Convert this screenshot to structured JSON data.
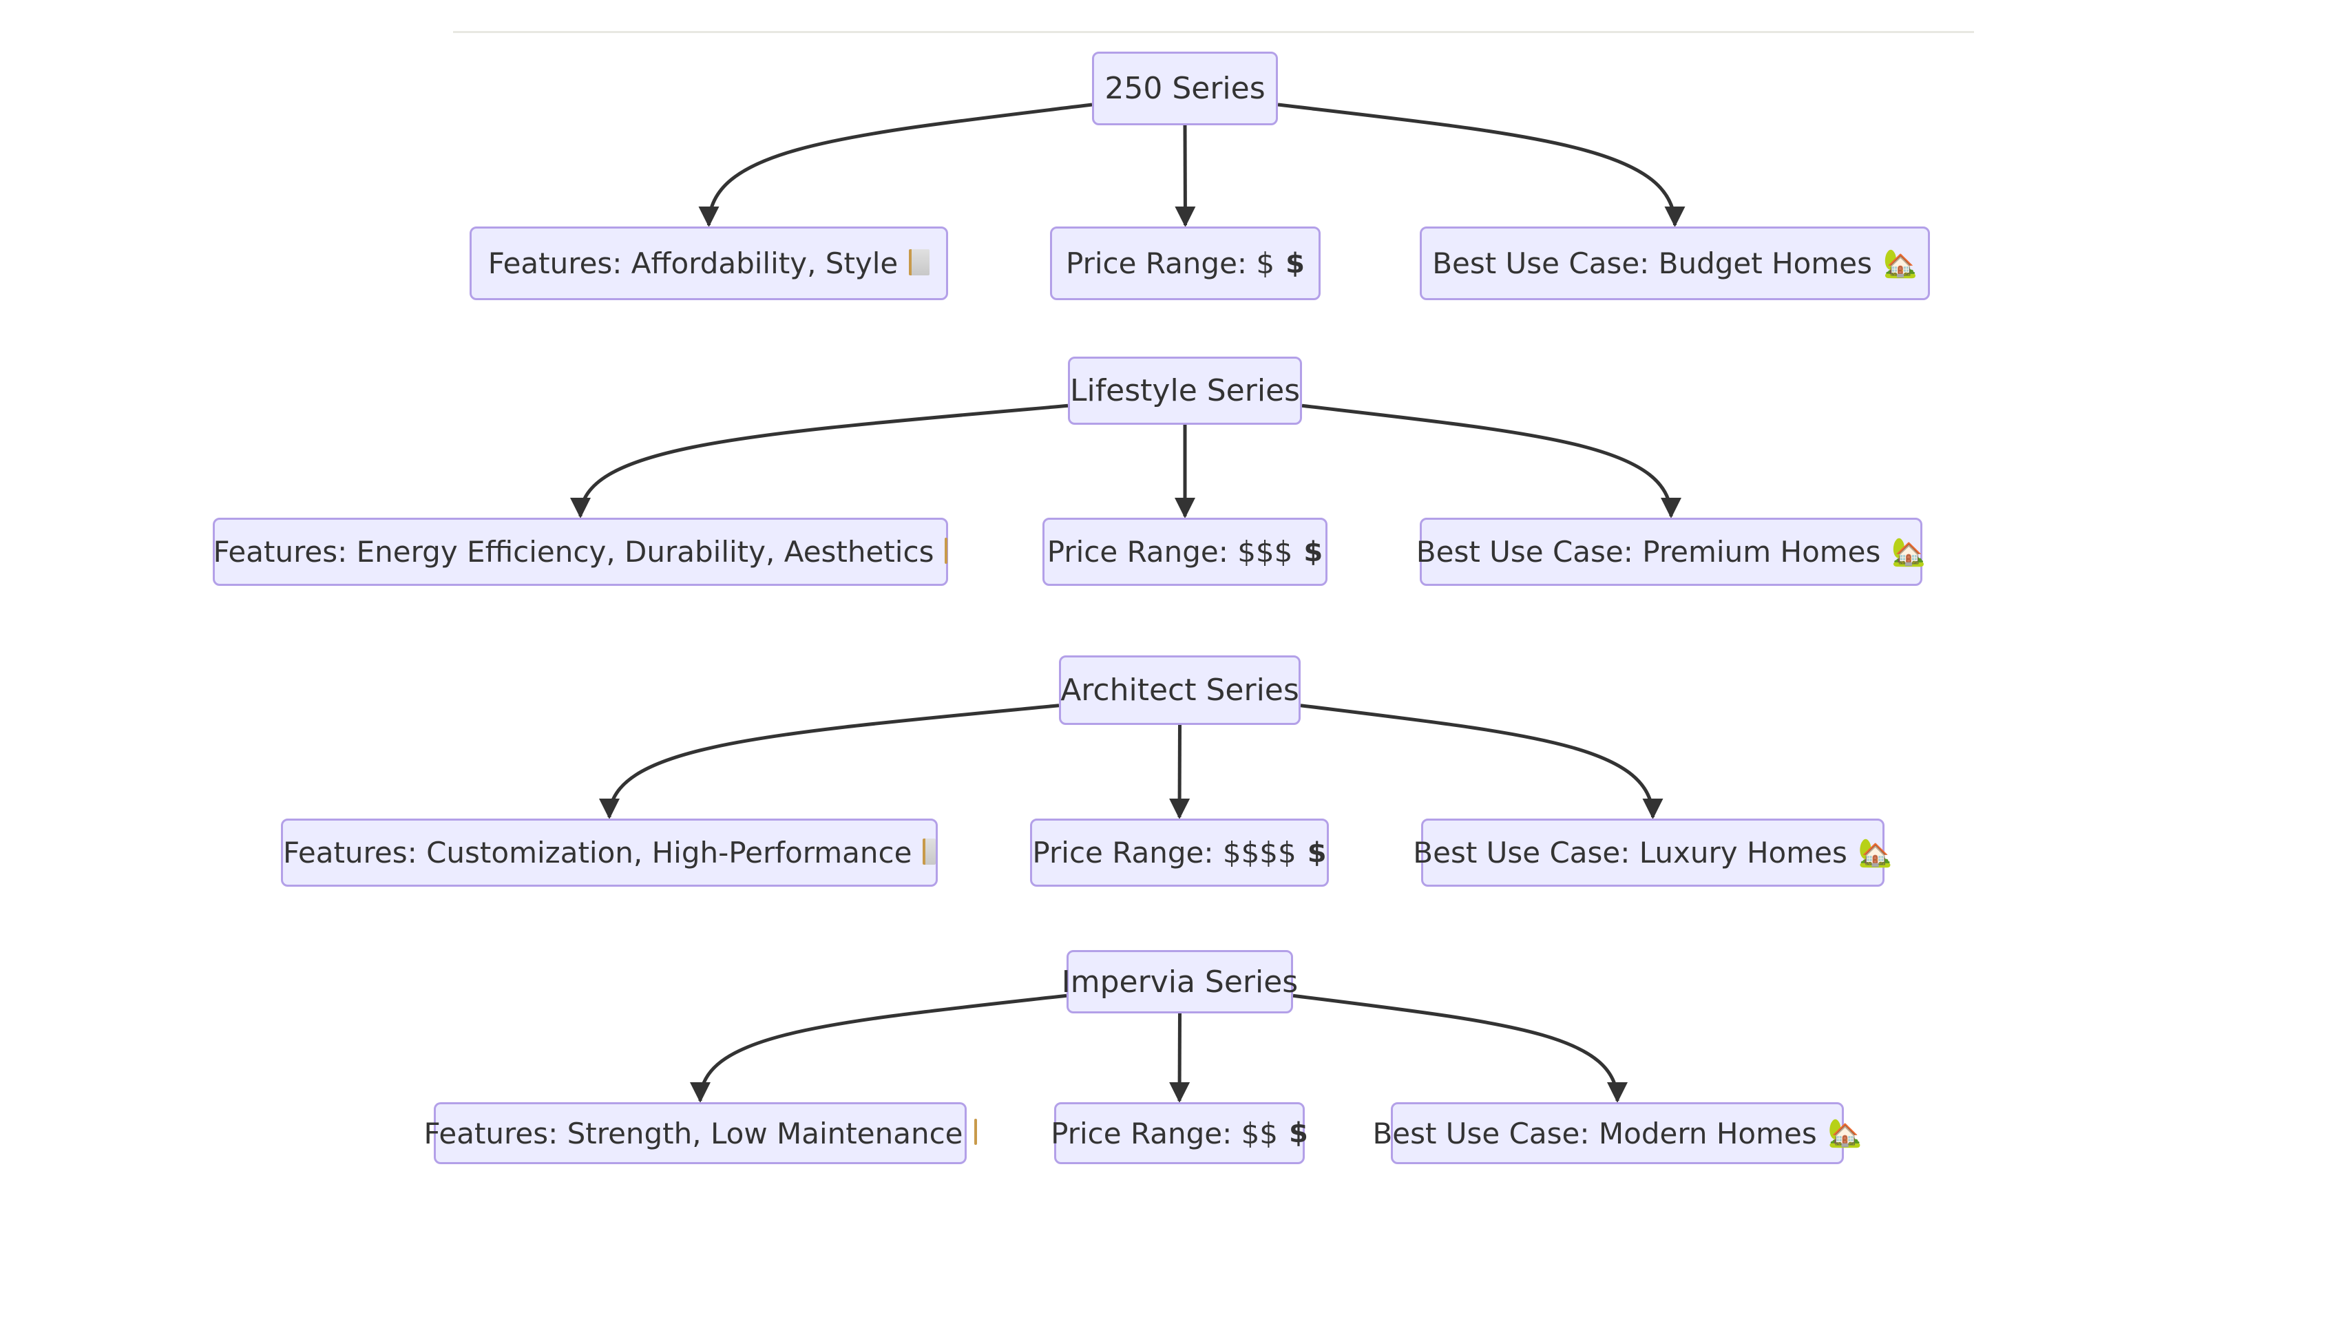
{
  "diagram": {
    "type": "flowchart",
    "colors": {
      "node_fill": "#ECECFF",
      "node_border": "#B3A0E8",
      "text": "#333333",
      "edge": "#333333"
    },
    "icons": {
      "features": "clipboard-icon",
      "price": "heavy-dollar-sign-icon",
      "use_case": "house-with-garden-icon"
    },
    "groups": [
      {
        "series": "250 Series",
        "features": "Features: Affordability, Style",
        "price": "Price Range: $",
        "use_case": "Best Use Case: Budget Homes"
      },
      {
        "series": "Lifestyle Series",
        "features": "Features: Energy Efficiency, Durability, Aesthetics",
        "price": "Price Range: $$$",
        "use_case": "Best Use Case: Premium Homes"
      },
      {
        "series": "Architect Series",
        "features": "Features: Customization, High-Performance",
        "price": "Price Range: $$$$",
        "use_case": "Best Use Case: Luxury Homes"
      },
      {
        "series": "Impervia Series",
        "features": "Features: Strength, Low Maintenance",
        "price": "Price Range: $$",
        "use_case": "Best Use Case: Modern Homes"
      }
    ],
    "edges": [
      {
        "from": "250 Series",
        "to": "Features: Affordability, Style"
      },
      {
        "from": "250 Series",
        "to": "Price Range: $"
      },
      {
        "from": "250 Series",
        "to": "Best Use Case: Budget Homes"
      },
      {
        "from": "Lifestyle Series",
        "to": "Features: Energy Efficiency, Durability, Aesthetics"
      },
      {
        "from": "Lifestyle Series",
        "to": "Price Range: $$$"
      },
      {
        "from": "Lifestyle Series",
        "to": "Best Use Case: Premium Homes"
      },
      {
        "from": "Architect Series",
        "to": "Features: Customization, High-Performance"
      },
      {
        "from": "Architect Series",
        "to": "Price Range: $$$$"
      },
      {
        "from": "Architect Series",
        "to": "Best Use Case: Luxury Homes"
      },
      {
        "from": "Impervia Series",
        "to": "Features: Strength, Low Maintenance"
      },
      {
        "from": "Impervia Series",
        "to": "Price Range: $$"
      },
      {
        "from": "Impervia Series",
        "to": "Best Use Case: Modern Homes"
      }
    ]
  }
}
